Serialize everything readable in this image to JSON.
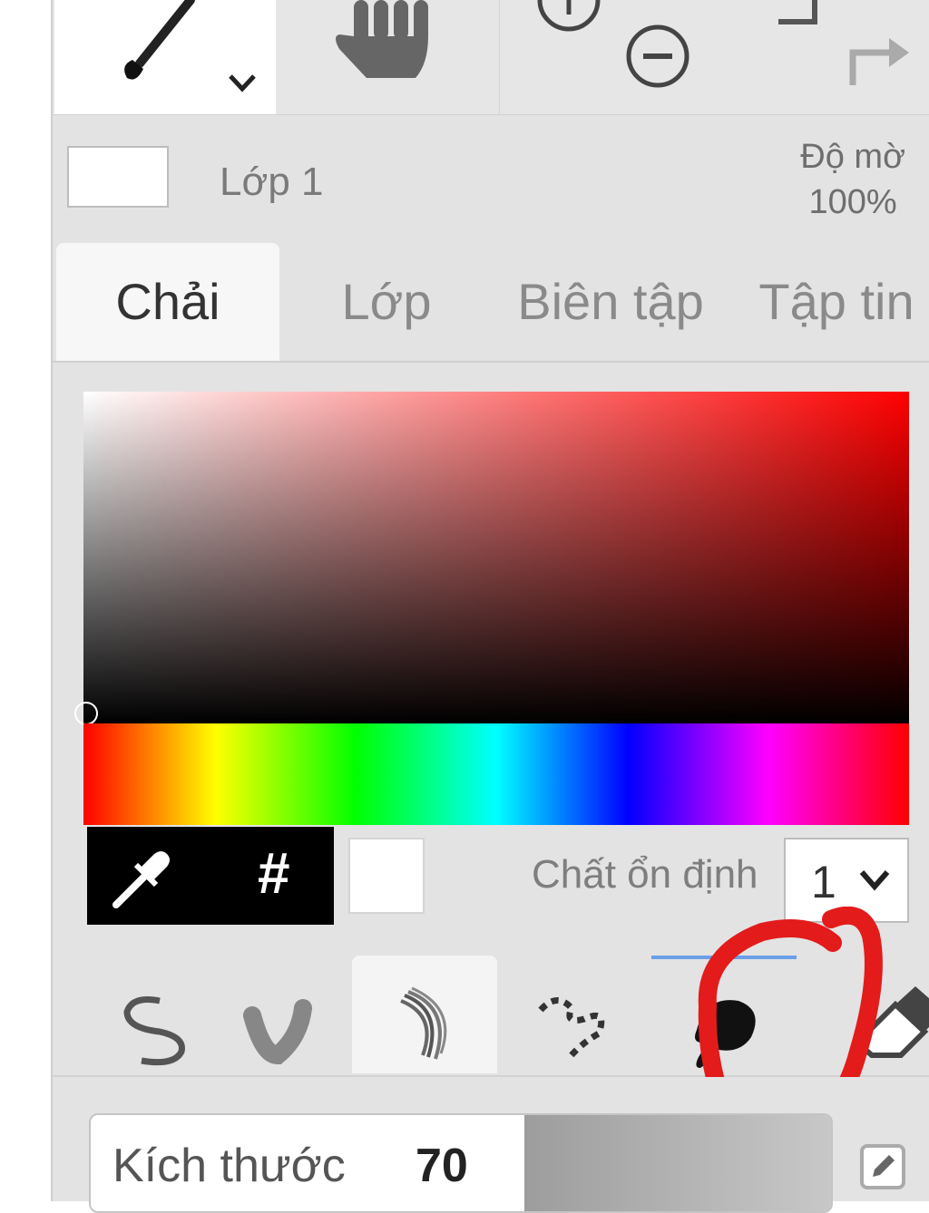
{
  "toolbar": {
    "brush_tool_icon": "brush-icon",
    "hand_tool_icon": "hand-icon",
    "zoom_in_icon": "zoom-in-icon",
    "zoom_out_icon": "zoom-out-icon",
    "redo_icon": "redo-icon"
  },
  "layer": {
    "name": "Lớp 1",
    "opacity_label": "Độ mờ",
    "opacity_value": "100%"
  },
  "tabs": [
    {
      "label": "Chải",
      "active": true
    },
    {
      "label": "Lớp",
      "active": false
    },
    {
      "label": "Biên tập",
      "active": false
    },
    {
      "label": "Tập tin",
      "active": false
    }
  ],
  "color_picker": {
    "base_hue": "#ff0000",
    "selected_color": "#ffffff",
    "hex_symbol": "#",
    "stabilizer_label": "Chất ổn định",
    "stabilizer_value": "1"
  },
  "brush_types": [
    {
      "name": "simple-stroke",
      "icon": "simple-brush-icon"
    },
    {
      "name": "blur-stroke",
      "icon": "blur-brush-icon"
    },
    {
      "name": "bristle",
      "icon": "bristle-brush-icon",
      "active": true
    },
    {
      "name": "dotted",
      "icon": "dotted-brush-icon"
    },
    {
      "name": "fill",
      "icon": "fill-brush-icon",
      "selected": true
    },
    {
      "name": "eraser",
      "icon": "eraser-icon"
    }
  ],
  "annotation": {
    "color": "#e31b1b"
  },
  "size": {
    "label": "Kích thước",
    "value": "70"
  }
}
